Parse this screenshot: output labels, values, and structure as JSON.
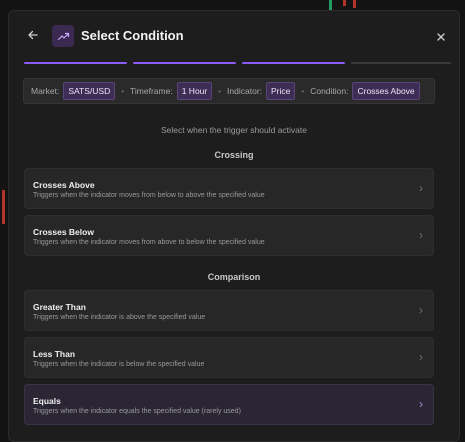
{
  "header": {
    "title": "Select Condition",
    "back_icon": "arrow-left-icon",
    "title_icon": "trending-up-icon",
    "close_icon": "close-icon"
  },
  "progress": {
    "total_steps": 4,
    "completed_steps": 3,
    "active_color": "#8b5cf6",
    "inactive_color": "#3a3a3a"
  },
  "summary": {
    "market_label": "Market:",
    "market_value": "SATS/USD",
    "timeframe_label": "Timeframe:",
    "timeframe_value": "1 Hour",
    "indicator_label": "Indicator:",
    "indicator_value": "Price",
    "condition_label": "Condition:",
    "condition_value": "Crosses Above"
  },
  "subtitle": "Select when the trigger should activate",
  "sections": {
    "crossing": {
      "title": "Crossing",
      "items": [
        {
          "name": "Crosses Above",
          "desc": "Triggers when the indicator moves from below to above the specified value"
        },
        {
          "name": "Crosses Below",
          "desc": "Triggers when the indicator moves from above to below the specified value"
        }
      ]
    },
    "comparison": {
      "title": "Comparison",
      "items": [
        {
          "name": "Greater Than",
          "desc": "Triggers when the indicator is above the specified value"
        },
        {
          "name": "Less Than",
          "desc": "Triggers when the indicator is below the specified value"
        },
        {
          "name": "Equals",
          "desc": "Triggers when the indicator equals the specified value (rarely used)"
        }
      ]
    }
  },
  "colors": {
    "accent": "#8b5cf6",
    "chip_bg": "#3e2e56",
    "candle_green": "#22a06b",
    "candle_red": "#c0392b"
  }
}
